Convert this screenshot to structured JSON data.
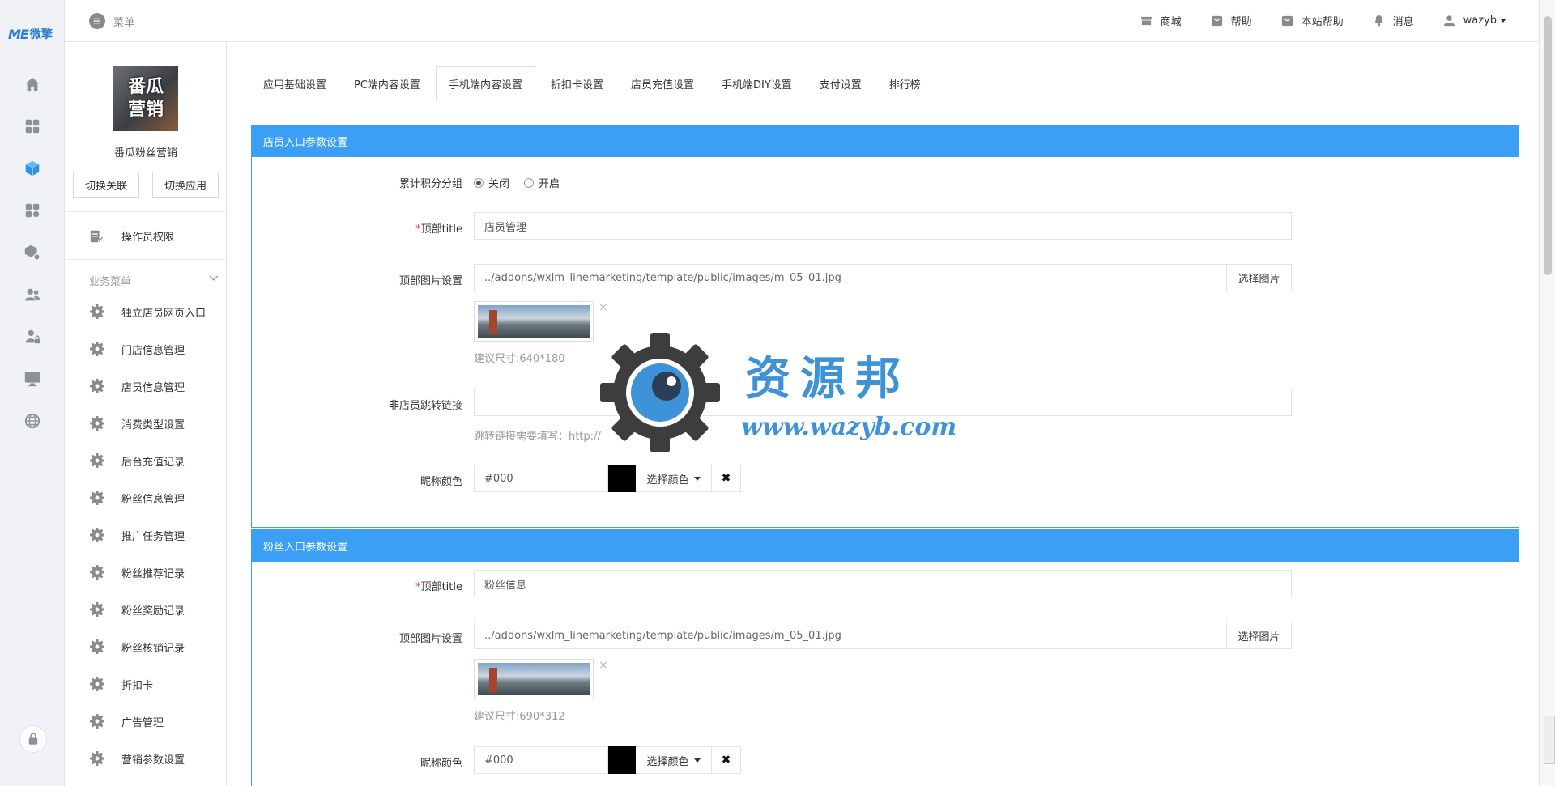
{
  "brand": {
    "mark": "ME",
    "name": "微擎"
  },
  "topbar": {
    "menu_label": "菜单",
    "links": [
      {
        "label": "商城",
        "icon": "store-icon"
      },
      {
        "label": "帮助",
        "icon": "help-bag-icon"
      },
      {
        "label": "本站帮助",
        "icon": "help-bag-icon"
      },
      {
        "label": "消息",
        "icon": "bell-icon"
      },
      {
        "label": "wazyb",
        "icon": "user-icon"
      }
    ]
  },
  "rail": {
    "icons": [
      "home-icon",
      "apps-grid-icon",
      "cube-icon",
      "modules-icon",
      "package-gear-icon",
      "users-icon",
      "user-lock-icon",
      "monitor-icon",
      "globe-icon"
    ],
    "active_index": 2,
    "bottom_icon": "lock-icon"
  },
  "app": {
    "avatar_text": "番瓜营销",
    "name": "番瓜粉丝营销",
    "switch_relation": "切换关联",
    "switch_app": "切换应用"
  },
  "sidebar": {
    "operator_permissions": "操作员权限",
    "biz_menu_title": "业务菜单",
    "items": [
      {
        "label": "独立店员网页入口"
      },
      {
        "label": "门店信息管理"
      },
      {
        "label": "店员信息管理"
      },
      {
        "label": "消费类型设置"
      },
      {
        "label": "后台充值记录"
      },
      {
        "label": "粉丝信息管理"
      },
      {
        "label": "推广任务管理"
      },
      {
        "label": "粉丝推荐记录"
      },
      {
        "label": "粉丝奖励记录"
      },
      {
        "label": "粉丝核销记录"
      },
      {
        "label": "折扣卡"
      },
      {
        "label": "广告管理"
      },
      {
        "label": "营销参数设置"
      }
    ]
  },
  "tabs": [
    {
      "label": "应用基础设置",
      "active": false
    },
    {
      "label": "PC端内容设置",
      "active": false
    },
    {
      "label": "手机端内容设置",
      "active": true
    },
    {
      "label": "折扣卡设置",
      "active": false
    },
    {
      "label": "店员充值设置",
      "active": false
    },
    {
      "label": "手机端DIY设置",
      "active": false
    },
    {
      "label": "支付设置",
      "active": false
    },
    {
      "label": "排行榜",
      "active": false
    }
  ],
  "panel1": {
    "title": "店员入口参数设置",
    "points_group": {
      "label": "累计积分分组",
      "options": [
        "关闭",
        "开启"
      ],
      "selected": "关闭"
    },
    "top_title": {
      "label": "顶部title",
      "value": "店员管理"
    },
    "top_image": {
      "label": "顶部图片设置",
      "value": "../addons/wxlm_linemarketing/template/public/images/m_05_01.jpg",
      "button": "选择图片",
      "hint": "建议尺寸:640*180"
    },
    "redirect": {
      "label": "非店员跳转链接",
      "value": "",
      "hint": "跳转链接需要填写：http://"
    },
    "nick_color": {
      "label": "昵称颜色",
      "value": "#000",
      "swatch": "#000000",
      "button": "选择颜色"
    }
  },
  "panel2": {
    "title": "粉丝入口参数设置",
    "top_title": {
      "label": "顶部title",
      "value": "粉丝信息"
    },
    "top_image": {
      "label": "顶部图片设置",
      "value": "../addons/wxlm_linemarketing/template/public/images/m_05_01.jpg",
      "button": "选择图片",
      "hint": "建议尺寸:690*312"
    },
    "nick_color": {
      "label": "昵称颜色",
      "value": "#000",
      "swatch": "#000000",
      "button": "选择颜色"
    }
  },
  "watermark": {
    "title": "资源邦",
    "url": "www.wazyb.com"
  },
  "colors": {
    "accent": "#3a9ff5",
    "required": "#e5322d"
  }
}
